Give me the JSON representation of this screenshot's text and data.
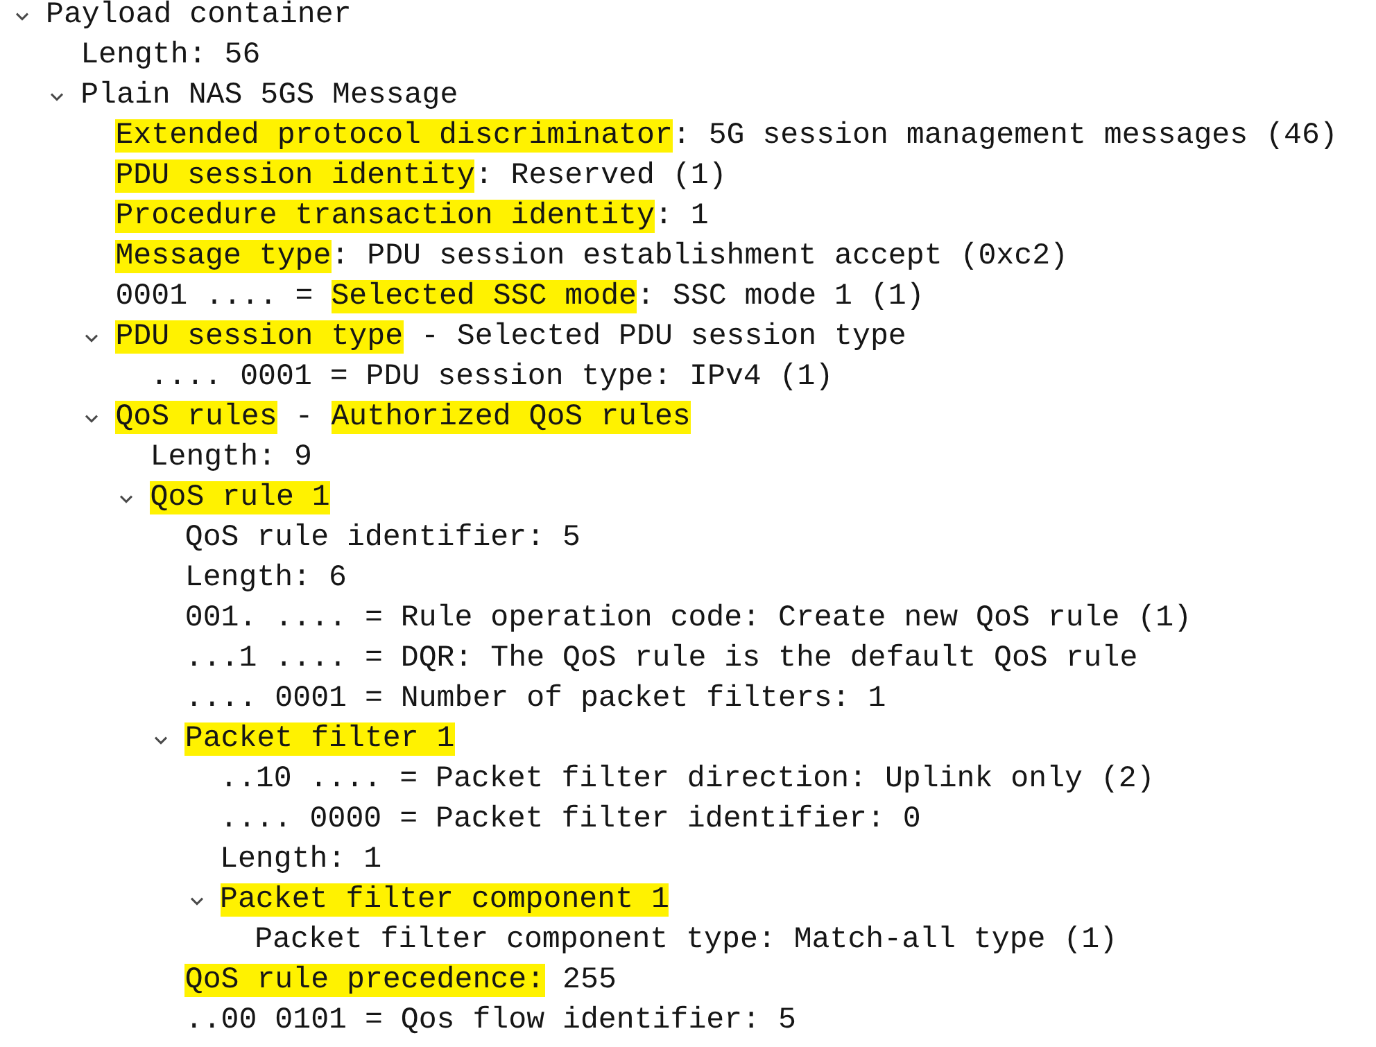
{
  "tree": [
    {
      "segments": [
        {
          "text": "Payload container",
          "highlighted": false
        }
      ],
      "expanded": true,
      "children": [
        {
          "segments": [
            {
              "text": "Length: 56",
              "highlighted": false
            }
          ]
        },
        {
          "segments": [
            {
              "text": "Plain NAS 5GS Message",
              "highlighted": false
            }
          ],
          "expanded": true,
          "children": [
            {
              "segments": [
                {
                  "text": "Extended protocol discriminator",
                  "highlighted": true
                },
                {
                  "text": ": 5G session management messages (46)",
                  "highlighted": false
                }
              ]
            },
            {
              "segments": [
                {
                  "text": "PDU session identity",
                  "highlighted": true
                },
                {
                  "text": ": Reserved (1)",
                  "highlighted": false
                }
              ]
            },
            {
              "segments": [
                {
                  "text": "Procedure transaction identity",
                  "highlighted": true
                },
                {
                  "text": ": 1",
                  "highlighted": false
                }
              ]
            },
            {
              "segments": [
                {
                  "text": "Message type",
                  "highlighted": true
                },
                {
                  "text": ": PDU session establishment accept (0xc2)",
                  "highlighted": false
                }
              ]
            },
            {
              "segments": [
                {
                  "text": "0001 .... = ",
                  "highlighted": false
                },
                {
                  "text": "Selected SSC mode",
                  "highlighted": true
                },
                {
                  "text": ": SSC mode 1 (1)",
                  "highlighted": false
                }
              ]
            },
            {
              "segments": [
                {
                  "text": "PDU session type",
                  "highlighted": true
                },
                {
                  "text": " - Selected PDU session type",
                  "highlighted": false
                }
              ],
              "expanded": true,
              "children": [
                {
                  "segments": [
                    {
                      "text": ".... 0001 = PDU session type: IPv4 (1)",
                      "highlighted": false
                    }
                  ]
                }
              ]
            },
            {
              "segments": [
                {
                  "text": "QoS rules",
                  "highlighted": true
                },
                {
                  "text": " - ",
                  "highlighted": false
                },
                {
                  "text": "Authorized QoS rules",
                  "highlighted": true
                }
              ],
              "expanded": true,
              "children": [
                {
                  "segments": [
                    {
                      "text": "Length: 9",
                      "highlighted": false
                    }
                  ]
                },
                {
                  "segments": [
                    {
                      "text": "QoS rule 1",
                      "highlighted": true
                    }
                  ],
                  "expanded": true,
                  "children": [
                    {
                      "segments": [
                        {
                          "text": "QoS rule identifier: 5",
                          "highlighted": false
                        }
                      ]
                    },
                    {
                      "segments": [
                        {
                          "text": "Length: 6",
                          "highlighted": false
                        }
                      ]
                    },
                    {
                      "segments": [
                        {
                          "text": "001. .... = Rule operation code: Create new QoS rule (1)",
                          "highlighted": false
                        }
                      ]
                    },
                    {
                      "segments": [
                        {
                          "text": "...1 .... = DQR: The QoS rule is the default QoS rule",
                          "highlighted": false
                        }
                      ]
                    },
                    {
                      "segments": [
                        {
                          "text": ".... 0001 = Number of packet filters: 1",
                          "highlighted": false
                        }
                      ]
                    },
                    {
                      "segments": [
                        {
                          "text": "Packet filter 1",
                          "highlighted": true
                        }
                      ],
                      "expanded": true,
                      "children": [
                        {
                          "segments": [
                            {
                              "text": "..10 .... = Packet filter direction: Uplink only (2)",
                              "highlighted": false
                            }
                          ]
                        },
                        {
                          "segments": [
                            {
                              "text": ".... 0000 = Packet filter identifier: 0",
                              "highlighted": false
                            }
                          ]
                        },
                        {
                          "segments": [
                            {
                              "text": "Length: 1",
                              "highlighted": false
                            }
                          ]
                        },
                        {
                          "segments": [
                            {
                              "text": "Packet filter component 1",
                              "highlighted": true
                            }
                          ],
                          "expanded": true,
                          "children": [
                            {
                              "segments": [
                                {
                                  "text": "Packet filter component type: Match-all type (1)",
                                  "highlighted": false
                                }
                              ]
                            }
                          ]
                        }
                      ]
                    },
                    {
                      "segments": [
                        {
                          "text": "QoS rule precedence:",
                          "highlighted": true
                        },
                        {
                          "text": " 255",
                          "highlighted": false
                        }
                      ]
                    },
                    {
                      "segments": [
                        {
                          "text": "..00 0101 = Qos flow identifier: 5",
                          "highlighted": false
                        }
                      ]
                    }
                  ]
                }
              ]
            }
          ]
        }
      ]
    }
  ]
}
